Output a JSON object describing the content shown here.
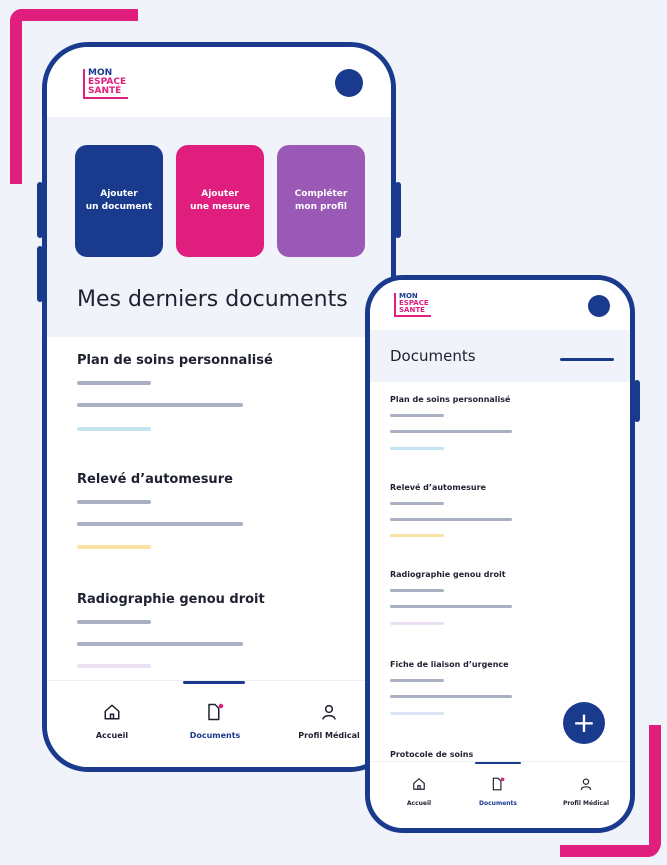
{
  "brand": {
    "logo_line1": "MON",
    "logo_line2": "ESPACE",
    "logo_line3": "SANTÉ"
  },
  "colors": {
    "primary": "#1a3b8d",
    "accent": "#e01e7e",
    "purple": "#9b59b6",
    "bg": "#f1f3fa"
  },
  "big_phone": {
    "actions": [
      {
        "label": "Ajouter\nun document",
        "color": "#1a3b8d"
      },
      {
        "label": "Ajouter\nune mesure",
        "color": "#e01e7e"
      },
      {
        "label": "Compléter\nmon profil",
        "color": "#9b59b6"
      }
    ],
    "section_title": "Mes derniers documents",
    "documents": [
      {
        "title": "Plan de soins personnalisé",
        "tag_color": "#c4e3f1"
      },
      {
        "title": "Relevé d’automesure",
        "tag_color": "#f8e2a6"
      },
      {
        "title": "Radiographie genou droit",
        "tag_color": "#ece1f3"
      }
    ],
    "nav": {
      "home": "Accueil",
      "documents": "Documents",
      "profile": "Profil Médical"
    }
  },
  "small_phone": {
    "section_title": "Documents",
    "documents": [
      {
        "title": "Plan de soins personnalisé",
        "tag_color": "#c4e3f1"
      },
      {
        "title": "Relevé d’automesure",
        "tag_color": "#f8e2a6"
      },
      {
        "title": "Radiographie genou droit",
        "tag_color": "#ece1f3"
      },
      {
        "title": "Fiche de liaison d’urgence",
        "tag_color": "#dde5f5"
      },
      {
        "title": "Protocole de soins",
        "tag_color": "#dde5f5"
      }
    ],
    "fab_label": "+",
    "nav": {
      "home": "Accueil",
      "documents": "Documents",
      "profile": "Profil Médical"
    }
  }
}
